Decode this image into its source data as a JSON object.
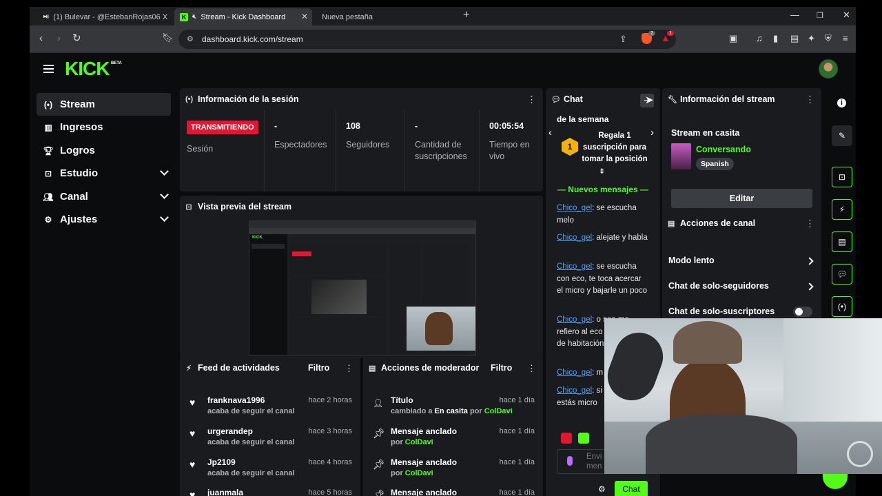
{
  "browser": {
    "tabs": [
      {
        "label": "(1) Bulevar - @EstebanRojas06 X"
      },
      {
        "label": "Stream - Kick Dashboard"
      },
      {
        "label": "Nueva pestaña"
      }
    ],
    "url": "dashboard.kick.com/stream",
    "shield_count": "2",
    "alert_count": "1"
  },
  "header": {
    "logo": "KICK",
    "logo_badge": "BETA"
  },
  "sidebar": {
    "items": [
      {
        "label": "Stream"
      },
      {
        "label": "Ingresos"
      },
      {
        "label": "Logros"
      },
      {
        "label": "Estudio"
      },
      {
        "label": "Canal"
      },
      {
        "label": "Ajustes"
      }
    ]
  },
  "session": {
    "title": "Información de la sesión",
    "status": "TRANSMITIENDO",
    "status_label": "Sesión",
    "stats": [
      {
        "value": "-",
        "label": "Espectadores"
      },
      {
        "value": "108",
        "label": "Seguidores"
      },
      {
        "value": "-",
        "label": "Cantidad de suscripciones"
      },
      {
        "value": "00:05:54",
        "label": "Tiempo en vivo"
      }
    ]
  },
  "preview": {
    "title": "Vista previa del stream"
  },
  "feed": {
    "title": "Feed de actividades",
    "filter": "Filtro",
    "items": [
      {
        "name": "franknava1996",
        "sub": "acaba de seguir el canal",
        "time": "hace 2 horas"
      },
      {
        "name": "urgerandep",
        "sub": "acaba de seguir el canal",
        "time": "hace 3 horas"
      },
      {
        "name": "Jp2109",
        "sub": "acaba de seguir el canal",
        "time": "hace 4 horas"
      },
      {
        "name": "juanmala",
        "sub": "",
        "time": "hace 5 horas"
      }
    ]
  },
  "moderator": {
    "title": "Acciones de moderador",
    "filter": "Filtro",
    "items": [
      {
        "name": "Título",
        "pre": "cambiado a ",
        "highlight": "En casita",
        "mid": " por ",
        "user": "ColDavi",
        "time": "hace 1 día"
      },
      {
        "name": "Mensaje anclado",
        "pre": "por ",
        "highlight": "",
        "mid": "",
        "user": "ColDavi",
        "time": "hace 1 día"
      },
      {
        "name": "Mensaje anclado",
        "pre": "por ",
        "highlight": "",
        "mid": "",
        "user": "ColDavi",
        "time": "hace 1 día"
      },
      {
        "name": "Mensaje anclado",
        "pre": "",
        "highlight": "",
        "mid": "",
        "user": "",
        "time": "hace 1 día"
      }
    ]
  },
  "chat": {
    "title": "Chat",
    "pinned_top": "de la semana",
    "gift_rank": "1",
    "gift_text": "Regala 1 suscripción para tomar la posición 1",
    "new_messages": "Nuevos mensajes",
    "messages": [
      {
        "user": "Chico_gel",
        "text": ": se escucha melo"
      },
      {
        "user": "Chico_gel",
        "text": ": alejate y habla"
      },
      {
        "user": "Chico_gel",
        "text": ": se escucha con eco, te toca acercar el micro y bajarle un poco"
      },
      {
        "user": "Chico_gel",
        "text": ": o sea me refiero al eco transfondo de habitación"
      },
      {
        "user": "Chico_gel",
        "text": ": m"
      },
      {
        "user": "Chico_gel",
        "text": ": si porque estás micro"
      }
    ],
    "input_placeholder": "Envi men",
    "send_label": "Chat"
  },
  "stream_info": {
    "title": "Información del stream",
    "stream_title": "Stream en casita",
    "category": "Conversando",
    "language": "Spanish",
    "edit_label": "Editar"
  },
  "channel_actions": {
    "title": "Acciones de canal",
    "items": [
      {
        "label": "Modo lento"
      },
      {
        "label": "Chat de solo-seguidores"
      },
      {
        "label": "Chat de solo-suscriptores"
      }
    ]
  },
  "colors": {
    "accent": "#53fc18",
    "live": "#e4162f",
    "panel": "#191b1f",
    "link": "#4da3ff"
  }
}
